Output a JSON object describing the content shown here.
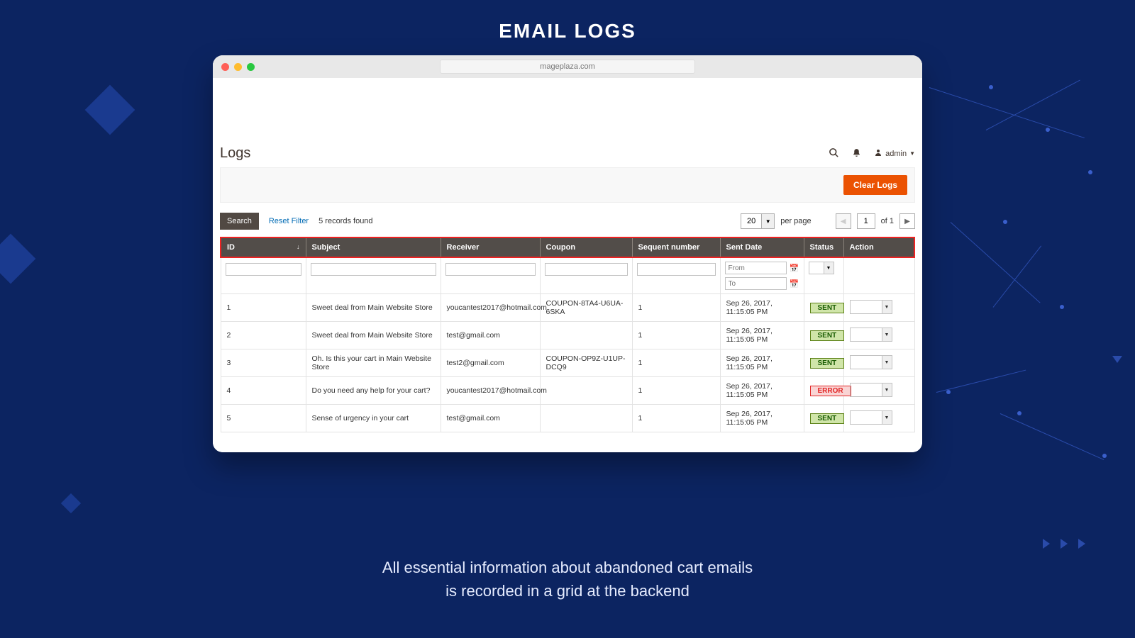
{
  "hero": {
    "title": "EMAIL LOGS",
    "caption_line1": "All essential information about abandoned cart emails",
    "caption_line2": "is recorded in a grid at the backend"
  },
  "browser": {
    "url": "mageplaza.com"
  },
  "header": {
    "page_title": "Logs",
    "admin_label": "admin"
  },
  "actions": {
    "clear_logs": "Clear Logs"
  },
  "toolbar": {
    "search": "Search",
    "reset_filter": "Reset Filter",
    "records_found": "5 records found",
    "per_page_value": "20",
    "per_page_label": "per page",
    "page_value": "1",
    "of_label": "of 1"
  },
  "columns": {
    "id": "ID",
    "subject": "Subject",
    "receiver": "Receiver",
    "coupon": "Coupon",
    "sequent": "Sequent number",
    "sent_date": "Sent Date",
    "status": "Status",
    "action": "Action"
  },
  "filters": {
    "from": "From",
    "to": "To"
  },
  "rows": [
    {
      "id": "1",
      "subject": "Sweet deal from Main Website Store",
      "receiver": "youcantest2017@hotmail.com",
      "coupon": "COUPON-8TA4-U6UA-6SKA",
      "sequent": "1",
      "sent_date": "Sep 26, 2017, 11:15:05 PM",
      "status": "SENT"
    },
    {
      "id": "2",
      "subject": "Sweet deal from Main Website Store",
      "receiver": "test@gmail.com",
      "coupon": "",
      "sequent": "1",
      "sent_date": "Sep 26, 2017, 11:15:05 PM",
      "status": "SENT"
    },
    {
      "id": "3",
      "subject": "Oh. Is this your cart in Main Website Store",
      "receiver": "test2@gmail.com",
      "coupon": "COUPON-OP9Z-U1UP-DCQ9",
      "sequent": "1",
      "sent_date": "Sep 26, 2017, 11:15:05 PM",
      "status": "SENT"
    },
    {
      "id": "4",
      "subject": "Do you need any help for your cart?",
      "receiver": "youcantest2017@hotmail.com",
      "coupon": "",
      "sequent": "1",
      "sent_date": "Sep 26, 2017, 11:15:05 PM",
      "status": "ERROR"
    },
    {
      "id": "5",
      "subject": "Sense of urgency in your cart",
      "receiver": "test@gmail.com",
      "coupon": "",
      "sequent": "1",
      "sent_date": "Sep 26, 2017, 11:15:05 PM",
      "status": "SENT"
    }
  ]
}
